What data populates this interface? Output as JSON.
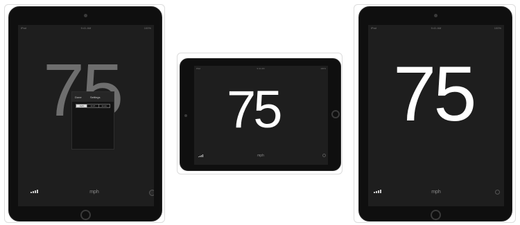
{
  "screenshots": [
    {
      "speed": "75",
      "unit": "mph",
      "status": {
        "carrier": "iPad",
        "time": "9:41 AM",
        "battery": "100%"
      },
      "settings_popover": {
        "done_label": "Done",
        "title": "Settings",
        "segments": [
          "mph",
          "km/h",
          "knots"
        ],
        "selected_segment": "mph"
      }
    },
    {
      "speed": "75",
      "unit": "mph",
      "status": {
        "carrier": "iPad",
        "time": "9:41 AM",
        "battery": "100%"
      }
    },
    {
      "speed": "75",
      "unit": "mph",
      "status": {
        "carrier": "iPad",
        "time": "9:41 AM",
        "battery": "100%"
      }
    }
  ],
  "icons": {
    "signal": "signal-strength-icon",
    "settings": "settings-icon"
  },
  "colors": {
    "background": "#ffffff",
    "device": "#0f0f0f",
    "screen": "#1e1e1e",
    "speed_text": "#ffffff",
    "speed_text_dimmed": "#6e6e6e"
  }
}
